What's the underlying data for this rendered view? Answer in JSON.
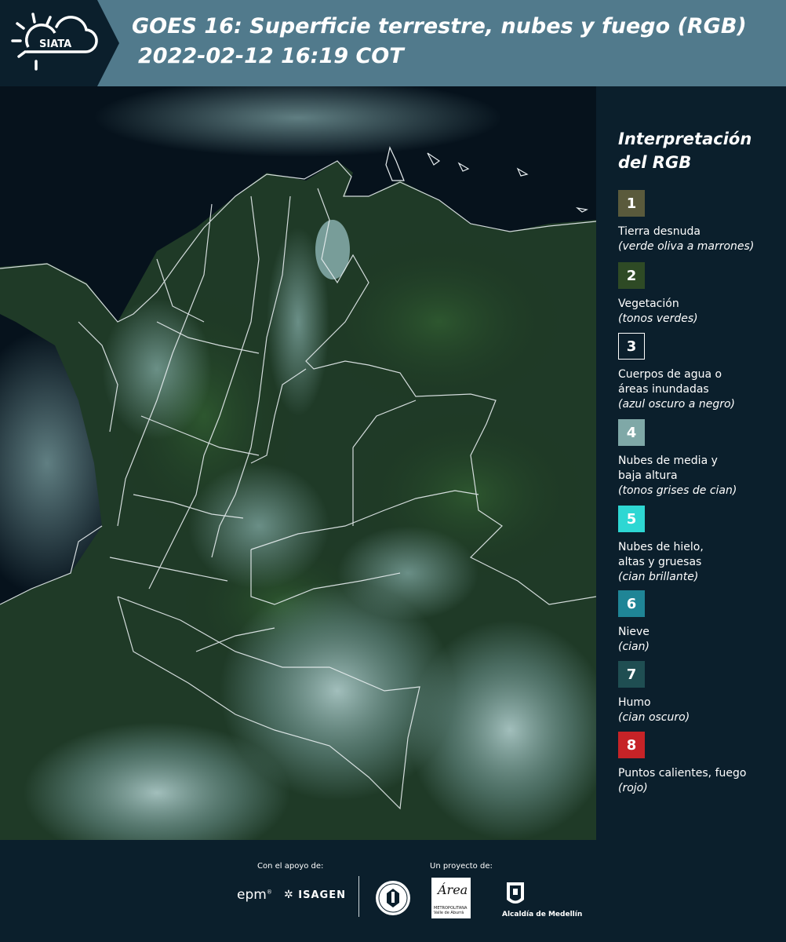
{
  "header": {
    "brand": "SIATA",
    "title": "GOES 16: Superficie terrestre, nubes y fuego (RGB)",
    "datetime": "2022-02-12 16:19 COT"
  },
  "legend": {
    "title_line1": "Interpretación",
    "title_line2": "del RGB",
    "items": [
      {
        "number": "1",
        "label": "Tierra desnuda",
        "sub": "(verde oliva a marrones)",
        "color": "#5a5a3c"
      },
      {
        "number": "2",
        "label": "Vegetación",
        "sub": "(tonos verdes)",
        "color": "#2e4a25"
      },
      {
        "number": "3",
        "label": "Cuerpos de agua o",
        "label2": "áreas inundadas",
        "sub": "(azul oscuro a negro)",
        "color": "#0b1f2c"
      },
      {
        "number": "4",
        "label": "Nubes de media y",
        "label2": "baja altura",
        "sub": "(tonos grises de cian)",
        "color": "#7fa8a7"
      },
      {
        "number": "5",
        "label": "Nubes de hielo,",
        "label2": "altas y gruesas",
        "sub": "(cian brillante)",
        "color": "#2ed7d3"
      },
      {
        "number": "6",
        "label": "Nieve",
        "sub": "(cian)",
        "color": "#1f8596"
      },
      {
        "number": "7",
        "label": "Humo",
        "sub": "(cian oscuro)",
        "color": "#1f4e52"
      },
      {
        "number": "8",
        "label": "Puntos calientes, fuego",
        "sub": "(rojo)",
        "color": "#c62327"
      }
    ]
  },
  "footer": {
    "support_label": "Con el apoyo de:",
    "project_label": "Un proyecto de:",
    "epm": "epm",
    "isagen": "ISAGEN",
    "area_word": "Área",
    "area_sub": "METROPOLITANA Valle de Aburrá",
    "alcaldia": "Alcaldía de Medellín"
  }
}
